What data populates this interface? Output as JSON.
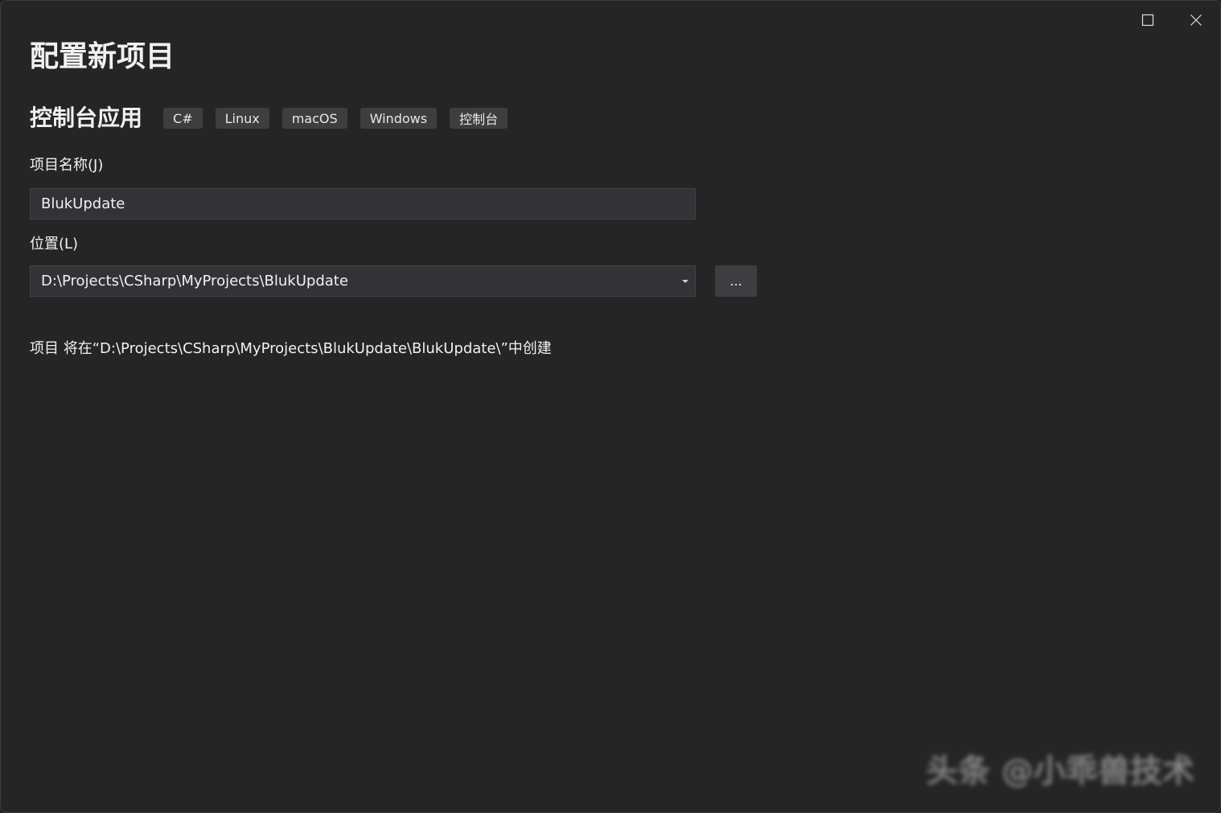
{
  "window": {
    "title": "配置新项目",
    "controls": {
      "maximize": "maximize-icon",
      "close": "close-icon"
    }
  },
  "template": {
    "name": "控制台应用",
    "tags": [
      "C#",
      "Linux",
      "macOS",
      "Windows",
      "控制台"
    ]
  },
  "project_name": {
    "label": "项目名称(J)",
    "value": "BlukUpdate"
  },
  "location": {
    "label": "位置(L)",
    "value": "D:\\Projects\\CSharp\\MyProjects\\BlukUpdate",
    "browse_label": "..."
  },
  "info": {
    "text": "项目 将在“D:\\Projects\\CSharp\\MyProjects\\BlukUpdate\\BlukUpdate\\”中创建"
  },
  "watermark": {
    "text": "头条 @小乖兽技术"
  },
  "colors": {
    "background": "#252526",
    "input_bg": "#333337",
    "tag_bg": "#3e3e40",
    "text": "#f1f1f1"
  }
}
